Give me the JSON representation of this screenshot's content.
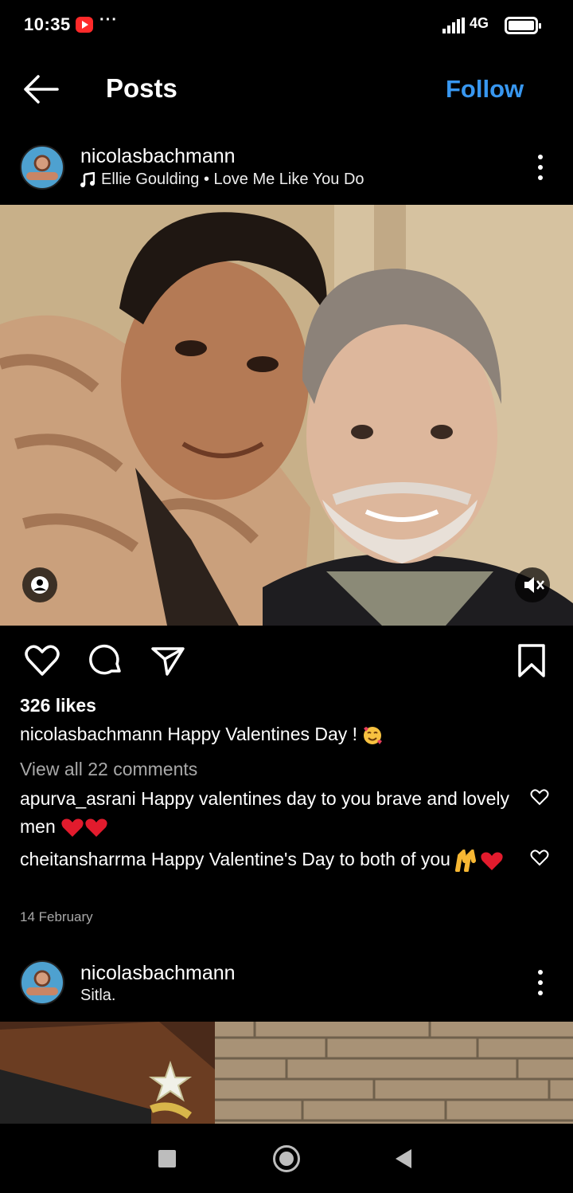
{
  "status_bar": {
    "time": "10:35",
    "dots": "···",
    "network": "4G",
    "badge_icon": "youtube-icon"
  },
  "header": {
    "title": "Posts",
    "follow_label": "Follow",
    "follow_color": "#3897f0"
  },
  "post1": {
    "username": "nicolasbachmann",
    "audio": "Ellie Goulding • Love Me Like You Do",
    "likes": "326 likes",
    "caption_user": "nicolasbachmann",
    "caption_text": "Happy Valentines Day !",
    "view_all": "View all 22 comments",
    "comments": [
      {
        "user": "apurva_asrani",
        "text": "Happy valentines day to you brave and lovely men"
      },
      {
        "user": "cheitansharrma",
        "text": "Happy Valentine's Day to both of you"
      }
    ],
    "date": "14 February"
  },
  "post2": {
    "username": "nicolasbachmann",
    "location": "Sitla."
  },
  "icons": [
    "back-arrow-icon",
    "music-note-icon",
    "more-vertical-icon",
    "heart-icon",
    "comment-icon",
    "share-icon",
    "bookmark-icon",
    "user-tag-icon",
    "mute-icon"
  ]
}
